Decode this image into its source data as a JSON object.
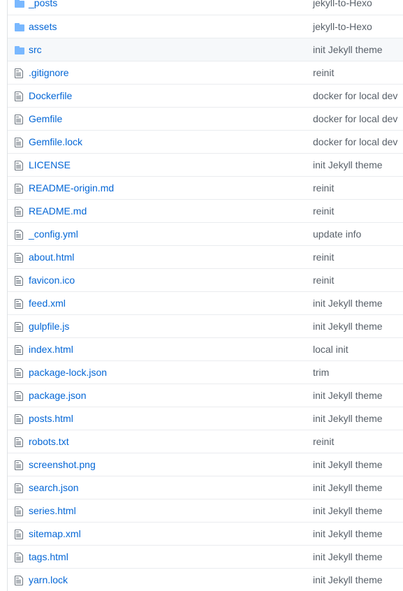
{
  "colors": {
    "link": "#0366d6",
    "folder_icon": "#79b8ff",
    "file_icon": "#6a737d",
    "message": "#586069"
  },
  "files": [
    {
      "name": "_posts",
      "type": "folder",
      "message": "jekyll-to-Hexo"
    },
    {
      "name": "assets",
      "type": "folder",
      "message": "jekyll-to-Hexo"
    },
    {
      "name": "src",
      "type": "folder",
      "message": "init Jekyll theme"
    },
    {
      "name": ".gitignore",
      "type": "file",
      "message": "reinit"
    },
    {
      "name": "Dockerfile",
      "type": "file",
      "message": "docker for local dev"
    },
    {
      "name": "Gemfile",
      "type": "file",
      "message": "docker for local dev"
    },
    {
      "name": "Gemfile.lock",
      "type": "file",
      "message": "docker for local dev"
    },
    {
      "name": "LICENSE",
      "type": "file",
      "message": "init Jekyll theme"
    },
    {
      "name": "README-origin.md",
      "type": "file",
      "message": "reinit"
    },
    {
      "name": "README.md",
      "type": "file",
      "message": "reinit"
    },
    {
      "name": "_config.yml",
      "type": "file",
      "message": "update info"
    },
    {
      "name": "about.html",
      "type": "file",
      "message": "reinit"
    },
    {
      "name": "favicon.ico",
      "type": "file",
      "message": "reinit"
    },
    {
      "name": "feed.xml",
      "type": "file",
      "message": "init Jekyll theme"
    },
    {
      "name": "gulpfile.js",
      "type": "file",
      "message": "init Jekyll theme"
    },
    {
      "name": "index.html",
      "type": "file",
      "message": "local init"
    },
    {
      "name": "package-lock.json",
      "type": "file",
      "message": "trim"
    },
    {
      "name": "package.json",
      "type": "file",
      "message": "init Jekyll theme"
    },
    {
      "name": "posts.html",
      "type": "file",
      "message": "init Jekyll theme"
    },
    {
      "name": "robots.txt",
      "type": "file",
      "message": "reinit"
    },
    {
      "name": "screenshot.png",
      "type": "file",
      "message": "init Jekyll theme"
    },
    {
      "name": "search.json",
      "type": "file",
      "message": "init Jekyll theme"
    },
    {
      "name": "series.html",
      "type": "file",
      "message": "init Jekyll theme"
    },
    {
      "name": "sitemap.xml",
      "type": "file",
      "message": "init Jekyll theme"
    },
    {
      "name": "tags.html",
      "type": "file",
      "message": "init Jekyll theme"
    },
    {
      "name": "yarn.lock",
      "type": "file",
      "message": "init Jekyll theme"
    }
  ]
}
